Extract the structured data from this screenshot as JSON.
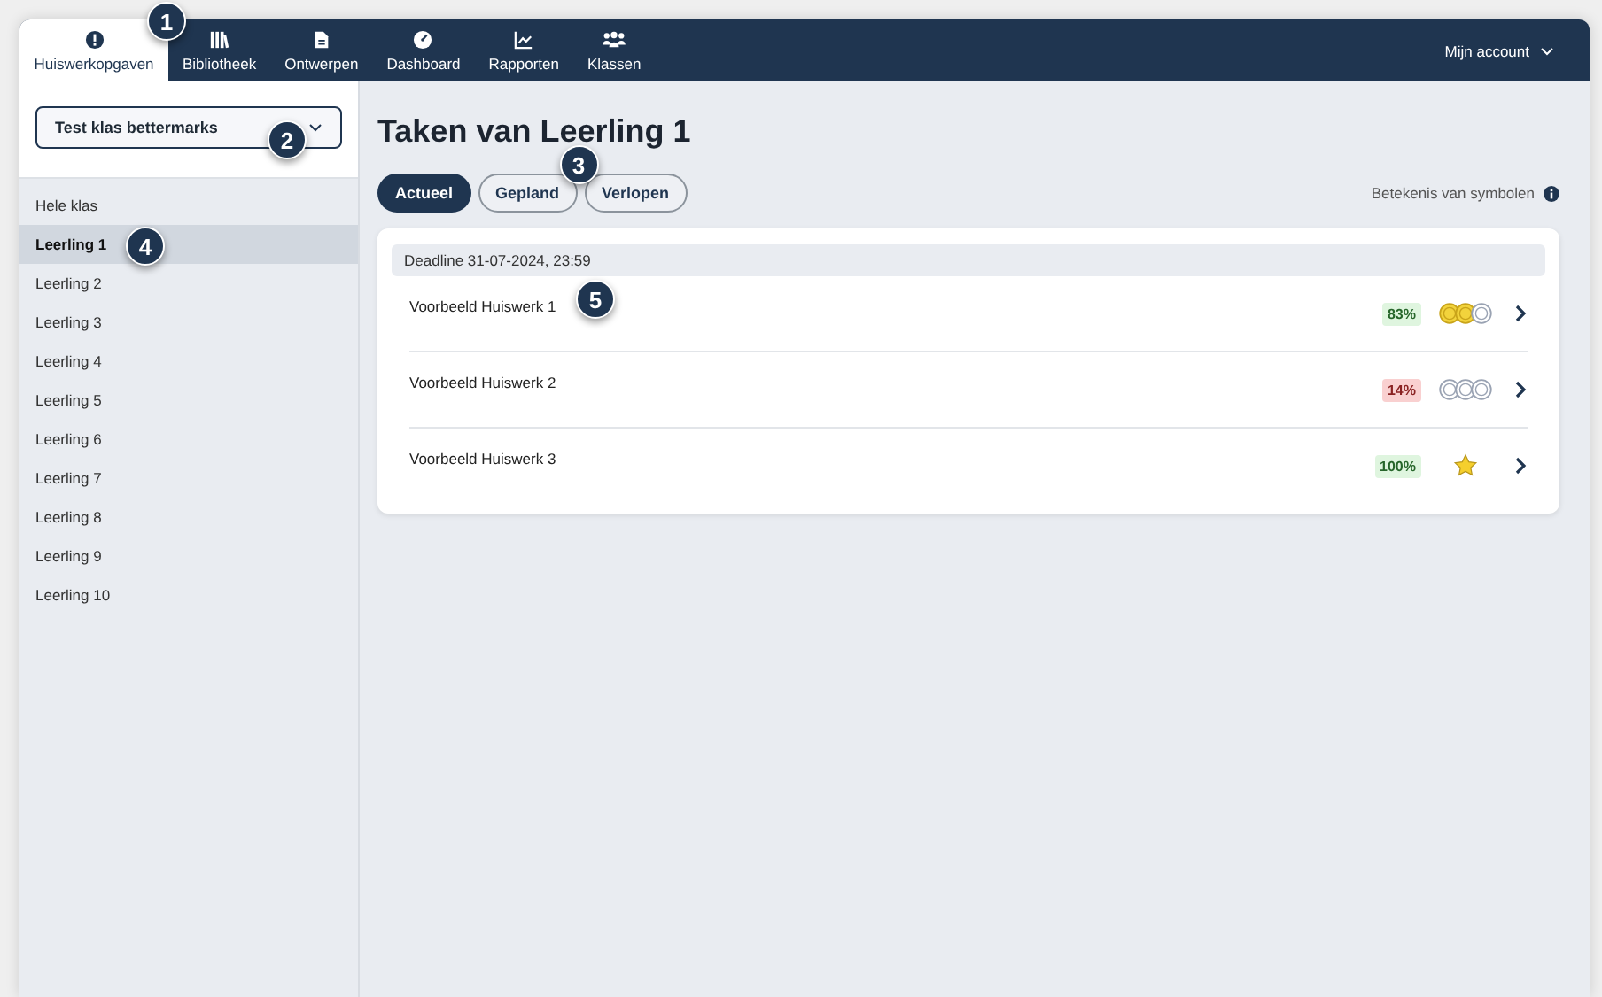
{
  "nav": {
    "tabs": [
      {
        "label": "Huiswerkopgaven",
        "selected": true,
        "callout": "1"
      },
      {
        "label": "Bibliotheek",
        "selected": false
      },
      {
        "label": "Ontwerpen",
        "selected": false
      },
      {
        "label": "Dashboard",
        "selected": false
      },
      {
        "label": "Rapporten",
        "selected": false
      },
      {
        "label": "Klassen",
        "selected": false
      }
    ],
    "account": "Mijn account"
  },
  "sidebar": {
    "class_select": {
      "value": "Test klas bettermarks",
      "callout": "2"
    },
    "items": [
      {
        "label": "Hele klas",
        "selected": false
      },
      {
        "label": "Leerling 1",
        "selected": true,
        "callout": "4"
      },
      {
        "label": "Leerling 2",
        "selected": false
      },
      {
        "label": "Leerling 3",
        "selected": false
      },
      {
        "label": "Leerling 4",
        "selected": false
      },
      {
        "label": "Leerling 5",
        "selected": false
      },
      {
        "label": "Leerling 6",
        "selected": false
      },
      {
        "label": "Leerling 7",
        "selected": false
      },
      {
        "label": "Leerling 8",
        "selected": false
      },
      {
        "label": "Leerling 9",
        "selected": false
      },
      {
        "label": "Leerling 10",
        "selected": false
      }
    ]
  },
  "main": {
    "title": "Taken van Leerling 1",
    "filters": [
      {
        "label": "Actueel",
        "selected": true
      },
      {
        "label": "Gepland",
        "selected": false,
        "callout": "3"
      },
      {
        "label": "Verlopen",
        "selected": false
      }
    ],
    "legend_link": "Betekenis van symbolen",
    "groups": [
      {
        "deadline": "Deadline 31-07-2024, 23:59",
        "tasks": [
          {
            "name": "Voorbeeld Huiswerk 1",
            "score": "83%",
            "passed": true,
            "kind": "coins",
            "coins": [
              {
                "earned": true
              },
              {
                "earned": true
              },
              {
                "earned": false
              }
            ],
            "callout": "5"
          },
          {
            "name": "Voorbeeld Huiswerk 2",
            "score": "14%",
            "passed": false,
            "kind": "coins",
            "coins": [
              {
                "earned": false
              },
              {
                "earned": false
              },
              {
                "earned": false
              }
            ]
          },
          {
            "name": "Voorbeeld Huiswerk 3",
            "score": "100%",
            "passed": true,
            "kind": "star"
          }
        ]
      }
    ]
  }
}
